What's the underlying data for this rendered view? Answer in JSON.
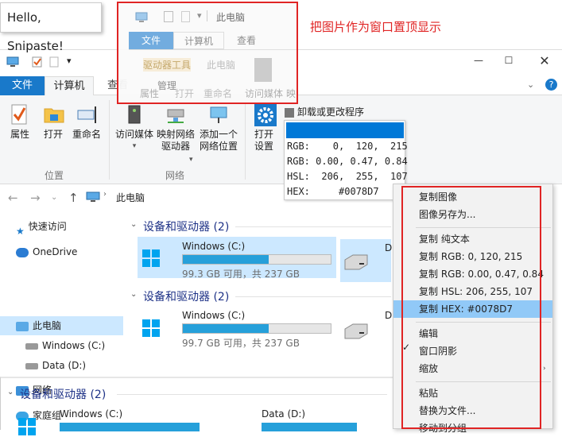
{
  "snip_window": {
    "hello_text": "Hello, Snipaste!",
    "title": "此电脑",
    "tabs": [
      "文件",
      "计算机",
      "查看"
    ],
    "ribbon_items": [
      "驱动器工具",
      "管理",
      "此电脑",
      "属性",
      "打开",
      "重命名",
      "访问媒体",
      "映"
    ]
  },
  "annotation": "把图片作为窗口置顶显示",
  "explorer": {
    "title_marker": "▾",
    "tabs": {
      "file": "文件",
      "computer": "计算机",
      "view": "查看"
    },
    "ribbon": {
      "properties": "属性",
      "open": "打开",
      "rename": "重命名",
      "access_media": "访问媒体",
      "map_drive_l1": "映射网络",
      "map_drive_l2": "驱动器",
      "add_location_l1": "添加一个",
      "add_location_l2": "网络位置",
      "open_settings_l1": "打开",
      "open_settings_l2": "设置",
      "uninstall": "卸载或更改程序",
      "group_location": "位置",
      "group_network": "网络"
    },
    "address": {
      "path": "此电脑"
    },
    "nav": {
      "quick_access": "快速访问",
      "onedrive": "OneDrive",
      "this_pc": "此电脑",
      "windows_c": "Windows (C:)",
      "data_d": "Data (D:)",
      "network": "网络",
      "homegroup": "家庭组"
    },
    "sections": [
      {
        "title": "设备和驱动器 (2)",
        "drive_name": "Windows (C:)",
        "drive_space": "99.3 GB 可用，共 237 GB",
        "fill": 0.58,
        "second_label": "D"
      },
      {
        "title": "设备和驱动器 (2)",
        "drive_name": "Windows (C:)",
        "drive_space": "99.7 GB 可用，共 237 GB",
        "fill": 0.58,
        "second_label": "D"
      },
      {
        "title": "设备和驱动器 (2)",
        "drive_name": "Windows (C:)",
        "drive2_name": "Data (D:)"
      }
    ]
  },
  "color_picker": {
    "swatch": "#0078D7",
    "rgb": "RGB:    0,  120,  215",
    "rgbf": "RGB: 0.00, 0.47, 0.84",
    "hsl": "HSL:  206,  255,  107",
    "hex": "HEX:     #0078D7"
  },
  "context_menu": {
    "items": [
      "复制图像",
      "图像另存为...",
      "复制 纯文本",
      "复制 RGB: 0, 120, 215",
      "复制 RGB: 0.00, 0.47, 0.84",
      "复制 HSL: 206, 255, 107",
      "复制 HEX: #0078D7",
      "编辑",
      "窗口阴影",
      "缩放",
      "粘贴",
      "替换为文件...",
      "移动到分组"
    ],
    "highlighted_index": 6,
    "checked_item": "窗口阴影"
  },
  "colors": {
    "accent": "#0078D7",
    "annotation_red": "#E02424",
    "highlight": "#91C9F7",
    "selection": "#CCE8FF"
  }
}
